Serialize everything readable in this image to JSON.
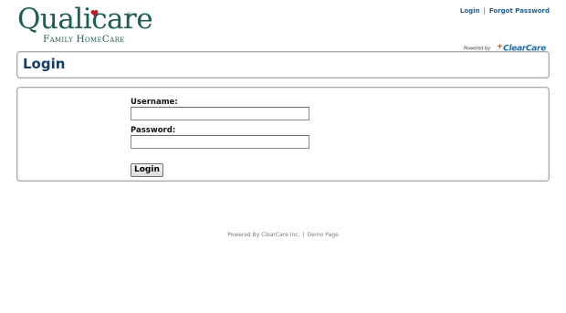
{
  "logo": {
    "word": "Qualicare",
    "registered": "®",
    "subtitle": "Family HomeCare",
    "heart_color": "#b3202c",
    "text_color": "#1f5e55"
  },
  "topnav": {
    "login": "Login",
    "separator": "|",
    "forgot_password": "Forgot Password"
  },
  "powered": {
    "by": "Powered by",
    "brand": "ClearCare"
  },
  "page": {
    "title": "Login"
  },
  "form": {
    "username_label": "Username:",
    "username_value": "",
    "password_label": "Password:",
    "password_value": "",
    "submit_label": "Login"
  },
  "footer": {
    "powered": "Powered By ClearCare Inc.",
    "separator": "|",
    "demo": "Demo Page"
  },
  "colors": {
    "title": "#153e66",
    "link": "#1f5d8a",
    "clearcare": "#1d6fa8",
    "clearcare_star": "#e4572e"
  }
}
